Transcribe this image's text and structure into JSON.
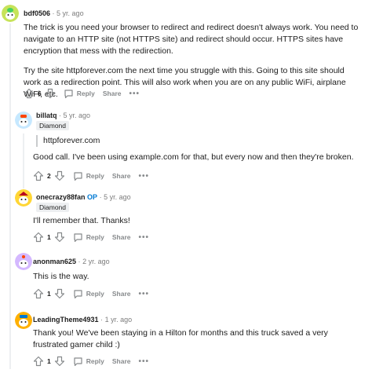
{
  "comments": [
    {
      "username": "bdf0506",
      "timestamp": "5 yr. ago",
      "paragraphs": [
        "The trick is you need your browser to redirect and redirect doesn't always work. You need to navigate to an HTTP site (not HTTPS site) and redirect should occur. HTTPS sites have encryption that mess with the redirection.",
        "Try the site httpforever.com the next time you struggle with this. Going to this site should work as a redirection point. This will also work when you are on any public WiFi, airplane WiFi, etc."
      ],
      "score": "6",
      "reply_label": "Reply",
      "share_label": "Share",
      "more_label": "•••"
    },
    {
      "username": "billatq",
      "timestamp": "5 yr. ago",
      "flair": "Diamond",
      "quote": "httpforever.com",
      "text": "Good call. I've been using example.com for that, but every now and then they're broken.",
      "score": "2",
      "reply_label": "Reply",
      "share_label": "Share",
      "more_label": "•••"
    },
    {
      "username": "onecrazy88fan",
      "op_badge": "OP",
      "timestamp": "5 yr. ago",
      "flair": "Diamond",
      "text": "I'll remember that. Thanks!",
      "score": "1",
      "reply_label": "Reply",
      "share_label": "Share",
      "more_label": "•••"
    },
    {
      "username": "anonman625",
      "timestamp": "2 yr. ago",
      "text": "This is the way.",
      "score": "1",
      "reply_label": "Reply",
      "share_label": "Share",
      "more_label": "•••"
    },
    {
      "username": "LeadingTheme4931",
      "timestamp": "1 yr. ago",
      "text": "Thank you! We've been staying in a Hilton for months and this truck saved a very frustrated gamer child :)",
      "score": "1",
      "reply_label": "Reply",
      "share_label": "Share",
      "more_label": "•••"
    }
  ],
  "separator": "·",
  "colors": {
    "upvote": "#878a8c",
    "op": "#0079d3",
    "flair_bg": "#edeff1"
  }
}
